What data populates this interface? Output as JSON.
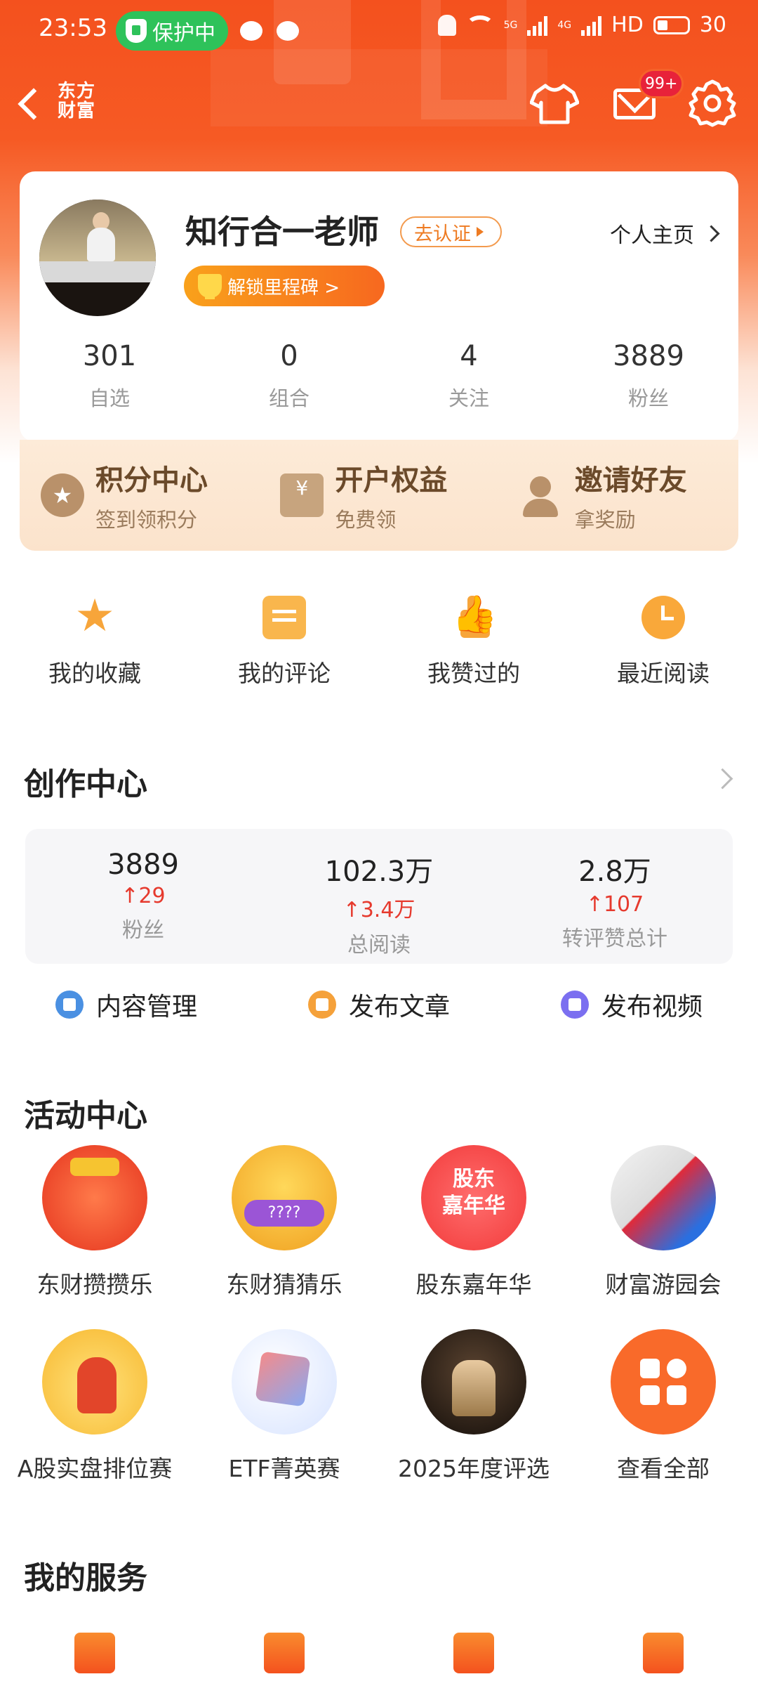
{
  "status_bar": {
    "time": "23:53",
    "protect_label": "保护中",
    "network_5g": "5G",
    "network_4g": "4G",
    "hd_label": "HD",
    "battery": "30"
  },
  "nav": {
    "logo_line1": "东方",
    "logo_line2": "财富",
    "mail_badge": "99+"
  },
  "profile": {
    "name": "知行合一老师",
    "verify_label": "去认证",
    "homepage_label": "个人主页",
    "milestone_label": "解锁里程碑 >",
    "stats": [
      {
        "num": "301",
        "label": "自选"
      },
      {
        "num": "0",
        "label": "组合"
      },
      {
        "num": "4",
        "label": "关注"
      },
      {
        "num": "3889",
        "label": "粉丝"
      }
    ]
  },
  "points_banner": [
    {
      "title": "积分中心",
      "sub": "签到领积分",
      "icon": "coin-star-icon"
    },
    {
      "title": "开户权益",
      "sub": "免费领",
      "icon": "gift-box-icon"
    },
    {
      "title": "邀请好友",
      "sub": "拿奖励",
      "icon": "add-user-icon"
    }
  ],
  "quick_links": [
    {
      "label": "我的收藏",
      "icon": "star-icon"
    },
    {
      "label": "我的评论",
      "icon": "comment-icon"
    },
    {
      "label": "我赞过的",
      "icon": "thumbs-up-icon"
    },
    {
      "label": "最近阅读",
      "icon": "clock-icon"
    }
  ],
  "creation": {
    "title": "创作中心",
    "stats": [
      {
        "num": "3889",
        "delta": "29",
        "label": "粉丝"
      },
      {
        "num": "102.3万",
        "delta": "3.4万",
        "label": "总阅读"
      },
      {
        "num": "2.8万",
        "delta": "107",
        "label": "转评赞总计"
      }
    ],
    "actions": [
      {
        "label": "内容管理",
        "color": "#4a90e2"
      },
      {
        "label": "发布文章",
        "color": "#f5a13a"
      },
      {
        "label": "发布视频",
        "color": "#7b6ff0"
      }
    ]
  },
  "activity": {
    "title": "活动中心",
    "items": [
      {
        "label": "东财攒攒乐"
      },
      {
        "label": "东财猜猜乐"
      },
      {
        "label": "股东嘉年华",
        "art_text_1": "股东",
        "art_text_2": "嘉年华"
      },
      {
        "label": "财富游园会"
      },
      {
        "label": "A股实盘排位赛"
      },
      {
        "label": "ETF菁英赛"
      },
      {
        "label": "2025年度评选"
      },
      {
        "label": "查看全部"
      }
    ]
  },
  "services": {
    "title": "我的服务"
  },
  "colors": {
    "brand_orange": "#f4511e",
    "accent_red": "#e63a2e",
    "protect_green": "#2ec25a"
  }
}
